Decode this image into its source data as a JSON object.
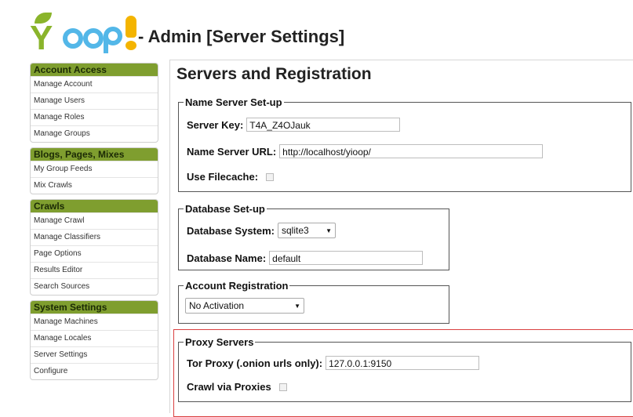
{
  "header": {
    "title": "- Admin [Server Settings]",
    "logo_text": "Yioop!"
  },
  "sidebar": {
    "groups": [
      {
        "heading": "Account Access",
        "items": [
          "Manage Account",
          "Manage Users",
          "Manage Roles",
          "Manage Groups"
        ]
      },
      {
        "heading": "Blogs, Pages, Mixes",
        "items": [
          "My Group Feeds",
          "Mix Crawls"
        ]
      },
      {
        "heading": "Crawls",
        "items": [
          "Manage Crawl",
          "Manage Classifiers",
          "Page Options",
          "Results Editor",
          "Search Sources"
        ]
      },
      {
        "heading": "System Settings",
        "items": [
          "Manage Machines",
          "Manage Locales",
          "Server Settings",
          "Configure"
        ]
      }
    ]
  },
  "main": {
    "heading": "Servers and Registration",
    "name_server": {
      "legend": "Name Server Set-up",
      "server_key_label": "Server Key:",
      "server_key_value": "T4A_Z4OJauk",
      "url_label": "Name Server URL:",
      "url_value": "http://localhost/yioop/",
      "filecache_label": "Use Filecache:"
    },
    "database": {
      "legend": "Database Set-up",
      "system_label": "Database System:",
      "system_value": "sqlite3",
      "name_label": "Database Name:",
      "name_value": "default"
    },
    "registration": {
      "legend": "Account Registration",
      "value": "No Activation"
    },
    "proxy": {
      "legend": "Proxy Servers",
      "tor_label": "Tor Proxy (.onion urls only):",
      "tor_value": "127.0.0.1:9150",
      "crawl_label": "Crawl via Proxies"
    }
  },
  "colors": {
    "sidebar_heading": "#7f9e2f",
    "highlight_border": "#d94040",
    "logo_green": "#8ab42b",
    "logo_blue": "#53b7e8",
    "logo_yellow": "#f4b400"
  }
}
